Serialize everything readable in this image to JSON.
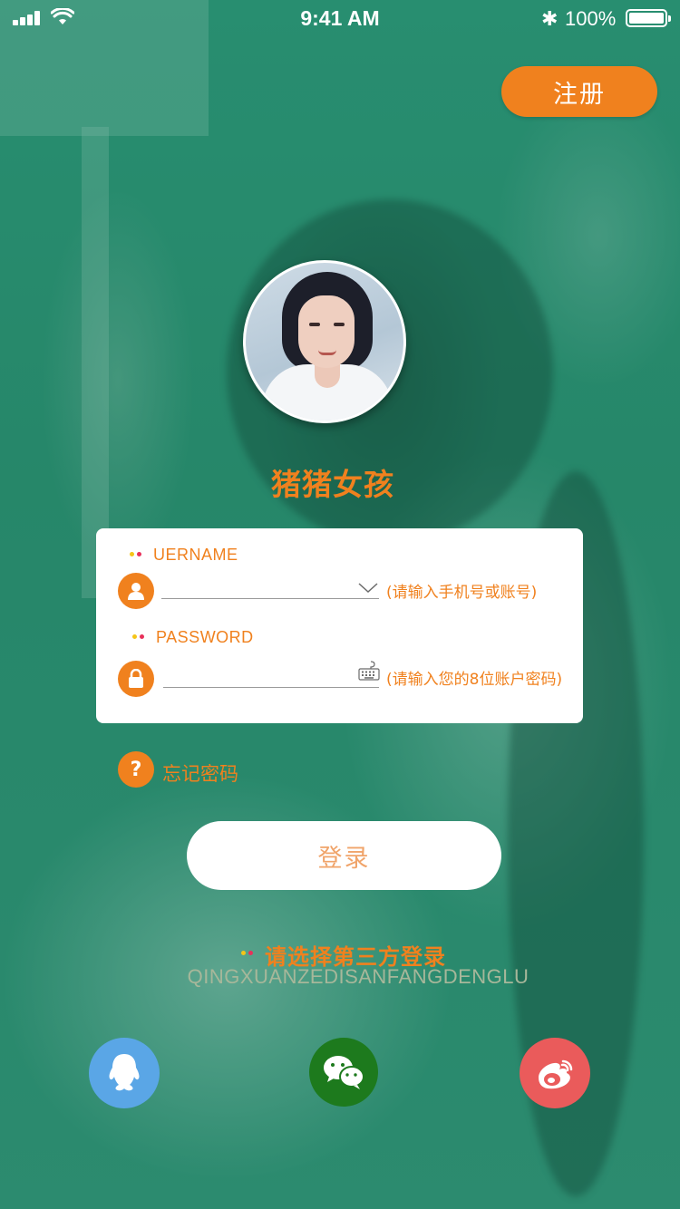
{
  "status_bar": {
    "time": "9:41 AM",
    "battery_percent": "100%",
    "bluetooth_glyph": "✱"
  },
  "header": {
    "register_label": "注册"
  },
  "profile": {
    "name": "猪猪女孩"
  },
  "form": {
    "username_label": "UERNAME",
    "username_hint": "(请输入手机号或账号)",
    "password_label": "PASSWORD",
    "password_hint": "(请输入您的8位账户密码)"
  },
  "forgot": {
    "icon_glyph": "?",
    "label": "忘记密码"
  },
  "login": {
    "label": "登录"
  },
  "third_party": {
    "title": "请选择第三方登录",
    "pinyin": "QINGXUANZEDISANFANGDENGLU",
    "providers": [
      "qq",
      "wechat",
      "weibo"
    ]
  },
  "colors": {
    "accent": "#f0811e",
    "background": "#2f8f73",
    "qq": "#5aa6e6",
    "wechat": "#1d7a1d",
    "weibo": "#ea5b5b"
  }
}
